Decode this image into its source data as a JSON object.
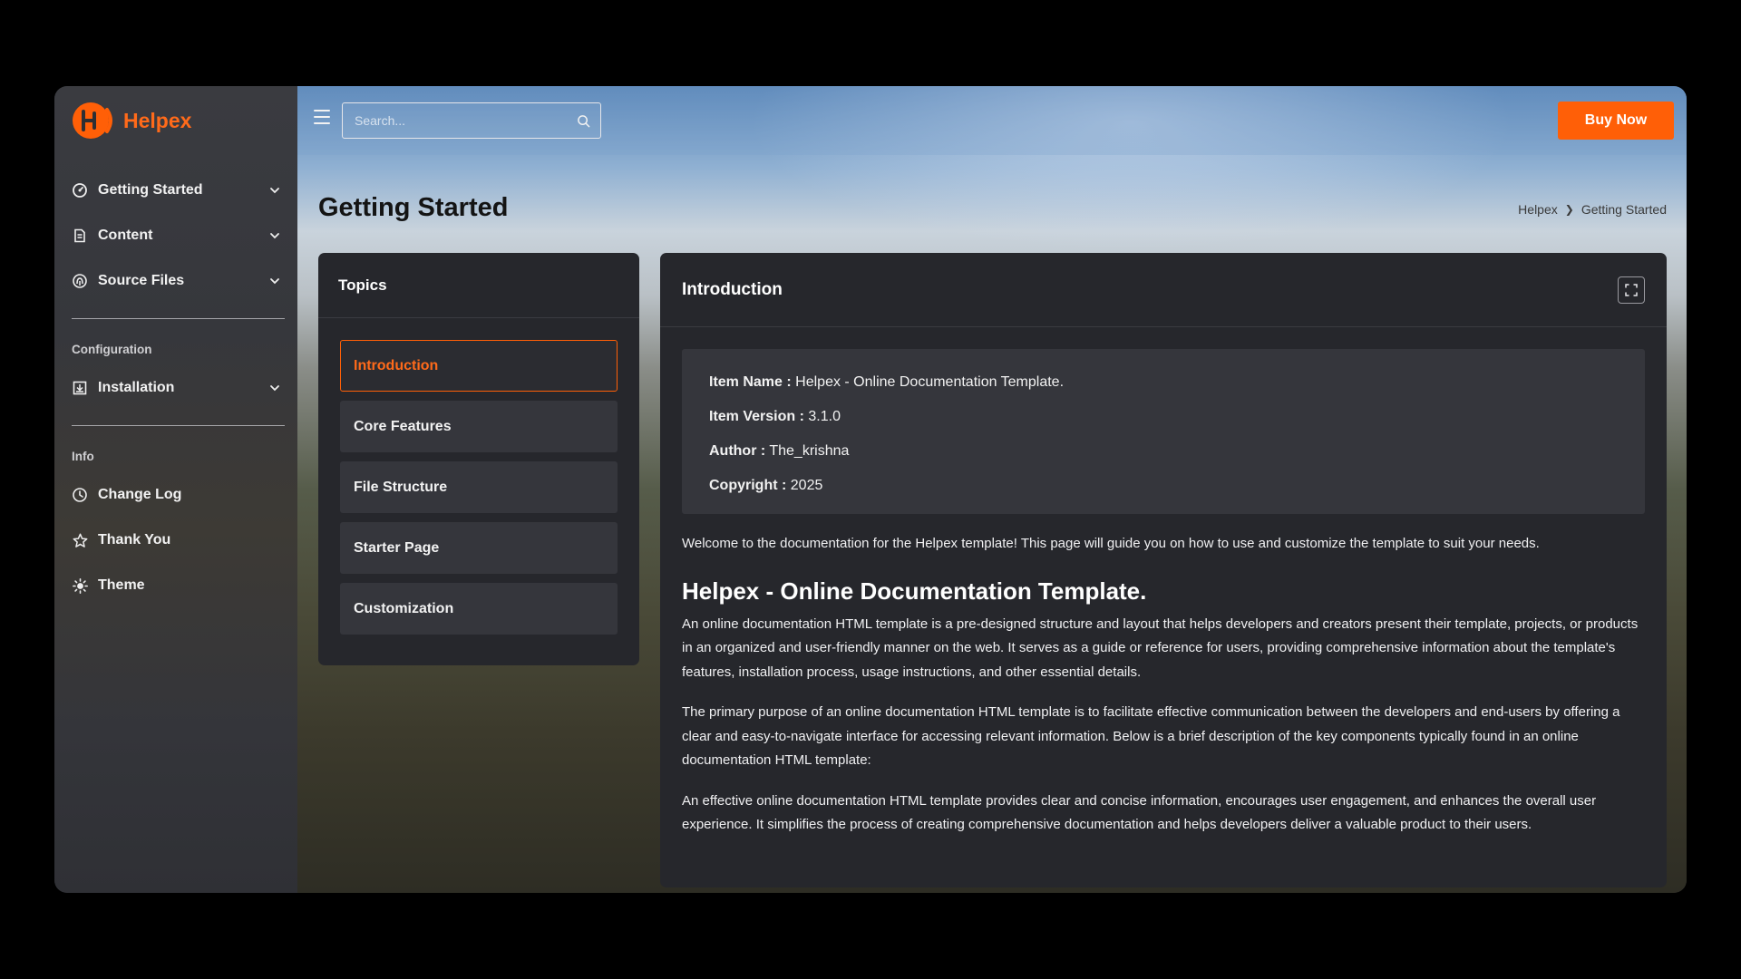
{
  "brand": {
    "name": "Helpex",
    "accent": "#ff5f07"
  },
  "sidebar": {
    "groups": [
      {
        "items": [
          {
            "label": "Getting Started",
            "icon": "gauge-icon",
            "has_children": true
          },
          {
            "label": "Content",
            "icon": "document-icon",
            "has_children": true
          },
          {
            "label": "Source Files",
            "icon": "fingerprint-icon",
            "has_children": true
          }
        ]
      },
      {
        "label": "Configuration",
        "items": [
          {
            "label": "Installation",
            "icon": "install-icon",
            "has_children": true
          }
        ]
      },
      {
        "label": "Info",
        "items": [
          {
            "label": "Change Log",
            "icon": "clock-icon",
            "has_children": false
          },
          {
            "label": "Thank You",
            "icon": "star-icon",
            "has_children": false
          },
          {
            "label": "Theme",
            "icon": "sun-icon",
            "has_children": false
          }
        ]
      }
    ]
  },
  "header": {
    "search_placeholder": "Search...",
    "buy_label": "Buy Now"
  },
  "page": {
    "title": "Getting Started",
    "breadcrumb": [
      "Helpex",
      "Getting Started"
    ]
  },
  "topics": {
    "title": "Topics",
    "items": [
      "Introduction",
      "Core Features",
      "File Structure",
      "Starter Page",
      "Customization"
    ],
    "active_index": 0
  },
  "content": {
    "title": "Introduction",
    "info": [
      {
        "key": "Item Name :",
        "value": "Helpex - Online Documentation Template."
      },
      {
        "key": "Item Version :",
        "value": "3.1.0"
      },
      {
        "key": "Author :",
        "value": "The_krishna"
      },
      {
        "key": "Copyright :",
        "value": "2025"
      }
    ],
    "welcome": "Welcome to the documentation for the Helpex template! This page will guide you on how to use and customize the template to suit your needs.",
    "heading": "Helpex - Online Documentation Template.",
    "paragraphs": [
      "An online documentation HTML template is a pre-designed structure and layout that helps developers and creators present their template, projects, or products in an organized and user-friendly manner on the web. It serves as a guide or reference for users, providing comprehensive information about the template's features, installation process, usage instructions, and other essential details.",
      "The primary purpose of an online documentation HTML template is to facilitate effective communication between the developers and end-users by offering a clear and easy-to-navigate interface for accessing relevant information. Below is a brief description of the key components typically found in an online documentation HTML template:",
      "An effective online documentation HTML template provides clear and concise information, encourages user engagement, and enhances the overall user experience. It simplifies the process of creating comprehensive documentation and helps developers deliver a valuable product to their users."
    ]
  }
}
